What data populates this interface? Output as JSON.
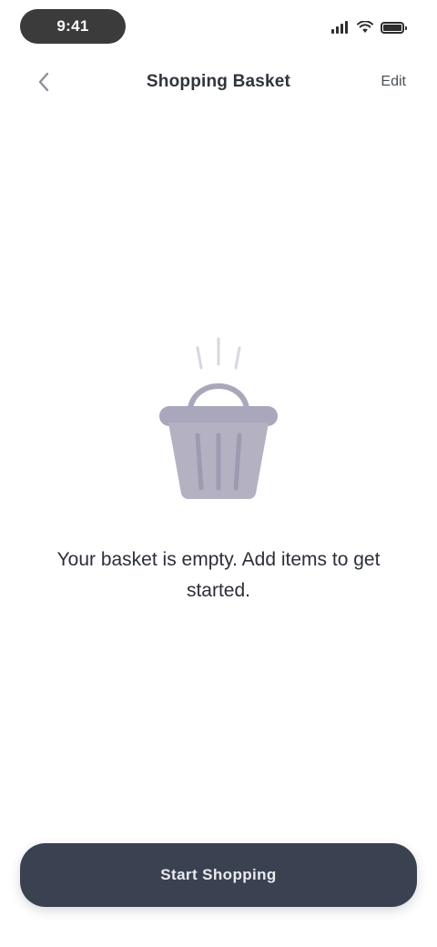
{
  "status_bar": {
    "time": "9:41"
  },
  "header": {
    "title": "Shopping Basket",
    "action_label": "Edit"
  },
  "empty_state": {
    "message": "Your basket is empty. Add items to get started."
  },
  "footer": {
    "button_label": "Start Shopping"
  },
  "colors": {
    "button_bg": "#3a4150",
    "basket_fill": "#b3b1c2",
    "basket_dark": "#9d9bb0"
  }
}
